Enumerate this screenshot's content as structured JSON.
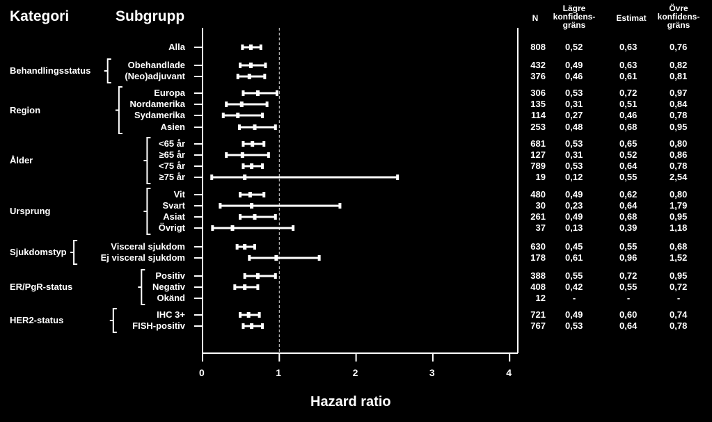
{
  "chart_data": {
    "type": "forest",
    "title": "",
    "xlabel": "Hazard ratio",
    "ylabel": "",
    "xlim": [
      0,
      4
    ],
    "xticks": [
      "0",
      "1",
      "2",
      "3",
      "4"
    ],
    "reference_line": 1,
    "column_headers": {
      "category": "Kategori",
      "subgroup": "Subgrupp",
      "n": "N",
      "lower": [
        "Lägre",
        "konfidens-",
        "gräns"
      ],
      "estimate": "Estimat",
      "upper": [
        "Övre",
        "konfidens-",
        "gräns"
      ]
    },
    "groups": [
      {
        "category": "",
        "rows": [
          {
            "subgroup": "Alla",
            "n": "808",
            "lower": "0,52",
            "estimate": "0,63",
            "upper": "0,76",
            "lo": 0.52,
            "est": 0.63,
            "hi": 0.76
          }
        ]
      },
      {
        "category": "Behandlingsstatus",
        "rows": [
          {
            "subgroup": "Obehandlade",
            "n": "432",
            "lower": "0,49",
            "estimate": "0,63",
            "upper": "0,82",
            "lo": 0.49,
            "est": 0.63,
            "hi": 0.82
          },
          {
            "subgroup": "(Neo)adjuvant",
            "n": "376",
            "lower": "0,46",
            "estimate": "0,61",
            "upper": "0,81",
            "lo": 0.46,
            "est": 0.61,
            "hi": 0.81
          }
        ]
      },
      {
        "category": "Region",
        "rows": [
          {
            "subgroup": "Europa",
            "n": "306",
            "lower": "0,53",
            "estimate": "0,72",
            "upper": "0,97",
            "lo": 0.53,
            "est": 0.72,
            "hi": 0.97
          },
          {
            "subgroup": "Nordamerika",
            "n": "135",
            "lower": "0,31",
            "estimate": "0,51",
            "upper": "0,84",
            "lo": 0.31,
            "est": 0.51,
            "hi": 0.84
          },
          {
            "subgroup": "Sydamerika",
            "n": "114",
            "lower": "0,27",
            "estimate": "0,46",
            "upper": "0,78",
            "lo": 0.27,
            "est": 0.46,
            "hi": 0.78
          },
          {
            "subgroup": "Asien",
            "n": "253",
            "lower": "0,48",
            "estimate": "0,68",
            "upper": "0,95",
            "lo": 0.48,
            "est": 0.68,
            "hi": 0.95
          }
        ]
      },
      {
        "category": "Ålder",
        "rows": [
          {
            "subgroup": "<65 år",
            "n": "681",
            "lower": "0,53",
            "estimate": "0,65",
            "upper": "0,80",
            "lo": 0.53,
            "est": 0.65,
            "hi": 0.8
          },
          {
            "subgroup": "≥65 år",
            "n": "127",
            "lower": "0,31",
            "estimate": "0,52",
            "upper": "0,86",
            "lo": 0.31,
            "est": 0.52,
            "hi": 0.86
          },
          {
            "subgroup": "<75 år",
            "n": "789",
            "lower": "0,53",
            "estimate": "0,64",
            "upper": "0,78",
            "lo": 0.53,
            "est": 0.64,
            "hi": 0.78
          },
          {
            "subgroup": "≥75 år",
            "n": "19",
            "lower": "0,12",
            "estimate": "0,55",
            "upper": "2,54",
            "lo": 0.12,
            "est": 0.55,
            "hi": 2.54
          }
        ]
      },
      {
        "category": "Ursprung",
        "rows": [
          {
            "subgroup": "Vit",
            "n": "480",
            "lower": "0,49",
            "estimate": "0,62",
            "upper": "0,80",
            "lo": 0.49,
            "est": 0.62,
            "hi": 0.8
          },
          {
            "subgroup": "Svart",
            "n": "30",
            "lower": "0,23",
            "estimate": "0,64",
            "upper": "1,79",
            "lo": 0.23,
            "est": 0.64,
            "hi": 1.79
          },
          {
            "subgroup": "Asiat",
            "n": "261",
            "lower": "0,49",
            "estimate": "0,68",
            "upper": "0,95",
            "lo": 0.49,
            "est": 0.68,
            "hi": 0.95
          },
          {
            "subgroup": "Övrigt",
            "n": "37",
            "lower": "0,13",
            "estimate": "0,39",
            "upper": "1,18",
            "lo": 0.13,
            "est": 0.39,
            "hi": 1.18
          }
        ]
      },
      {
        "category": "Sjukdomstyp",
        "rows": [
          {
            "subgroup": "Visceral sjukdom",
            "n": "630",
            "lower": "0,45",
            "estimate": "0,55",
            "upper": "0,68",
            "lo": 0.45,
            "est": 0.55,
            "hi": 0.68
          },
          {
            "subgroup": "Ej visceral sjukdom",
            "n": "178",
            "lower": "0,61",
            "estimate": "0,96",
            "upper": "1,52",
            "lo": 0.61,
            "est": 0.96,
            "hi": 1.52
          }
        ]
      },
      {
        "category": "ER/PgR-status",
        "rows": [
          {
            "subgroup": "Positiv",
            "n": "388",
            "lower": "0,55",
            "estimate": "0,72",
            "upper": "0,95",
            "lo": 0.55,
            "est": 0.72,
            "hi": 0.95
          },
          {
            "subgroup": "Negativ",
            "n": "408",
            "lower": "0,42",
            "estimate": "0,55",
            "upper": "0,72",
            "lo": 0.42,
            "est": 0.55,
            "hi": 0.72
          },
          {
            "subgroup": "Okänd",
            "n": "12",
            "lower": "-",
            "estimate": "-",
            "upper": "-",
            "lo": null,
            "est": null,
            "hi": null
          }
        ]
      },
      {
        "category": "HER2-status",
        "rows": [
          {
            "subgroup": "IHC 3+",
            "n": "721",
            "lower": "0,49",
            "estimate": "0,60",
            "upper": "0,74",
            "lo": 0.49,
            "est": 0.6,
            "hi": 0.74
          },
          {
            "subgroup": "FISH-positiv",
            "n": "767",
            "lower": "0,53",
            "estimate": "0,64",
            "upper": "0,78",
            "lo": 0.53,
            "est": 0.64,
            "hi": 0.78
          }
        ]
      }
    ]
  }
}
